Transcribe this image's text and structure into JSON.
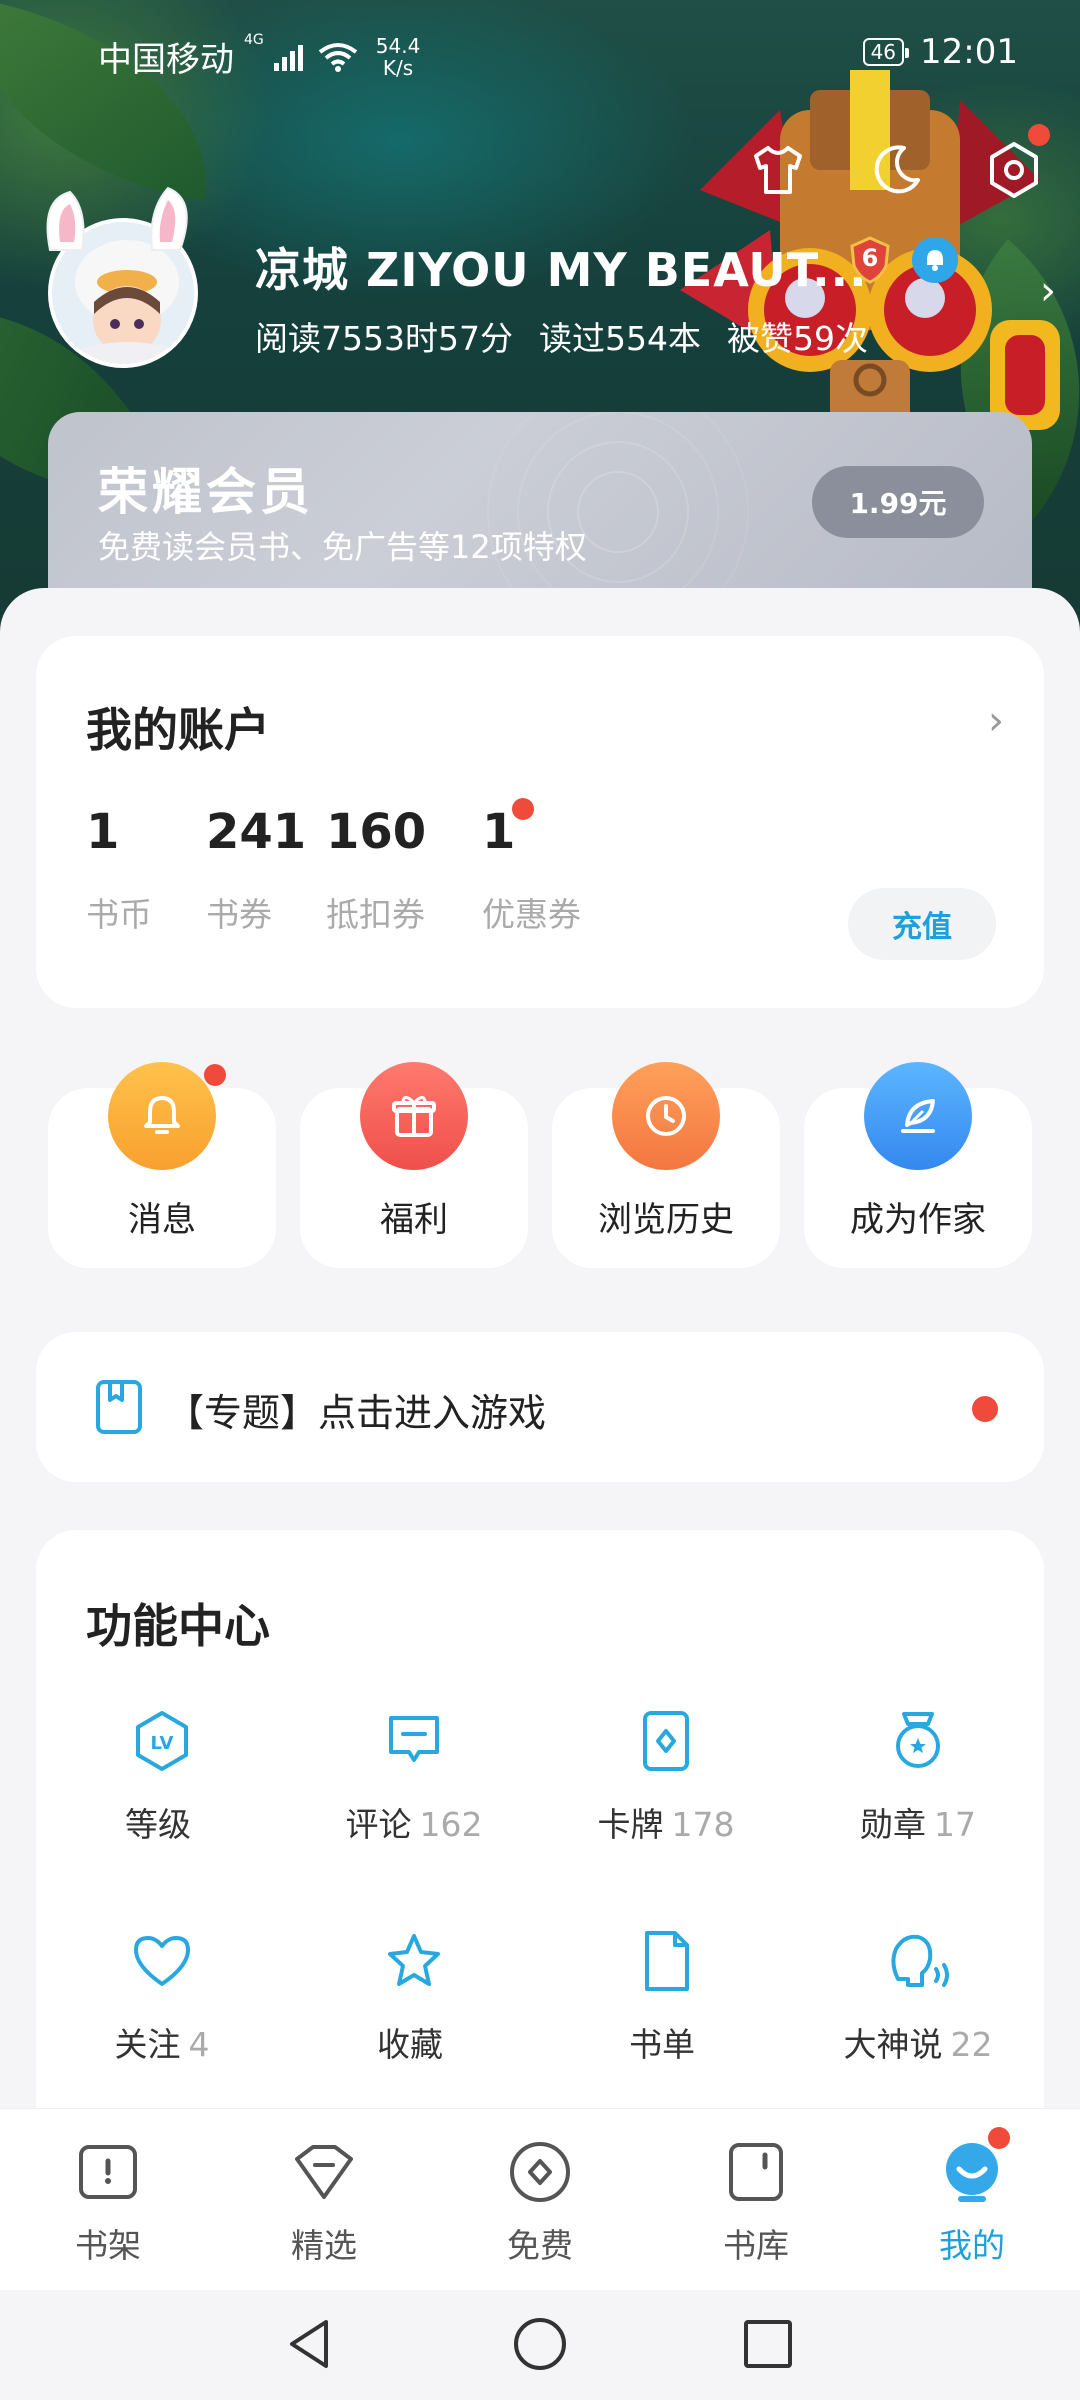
{
  "status_bar": {
    "carrier": "中国移动",
    "network": "4G",
    "speed_value": "54.4",
    "speed_unit": "K/s",
    "battery": "46",
    "time": "12:01"
  },
  "profile": {
    "name": "凉城 ZIYOU MY BEAUT...",
    "level_badge": "6",
    "stats": [
      "阅读7553时57分",
      "读过554本",
      "被赞59次"
    ]
  },
  "vip": {
    "title": "荣耀会员",
    "subtitle": "免费读会员书、免广告等12项特权",
    "price": "1.99元"
  },
  "account": {
    "title": "我的账户",
    "items": [
      {
        "value": "1",
        "label": "书币"
      },
      {
        "value": "241",
        "label": "书券"
      },
      {
        "value": "160",
        "label": "抵扣券"
      },
      {
        "value": "1",
        "label": "优惠券"
      }
    ],
    "recharge_label": "充值"
  },
  "quick_actions": [
    {
      "label": "消息",
      "icon": "bell-icon",
      "color": "#f9a93a"
    },
    {
      "label": "福利",
      "icon": "gift-icon",
      "color": "#f25f57"
    },
    {
      "label": "浏览历史",
      "icon": "clock-icon",
      "color": "#f7854a"
    },
    {
      "label": "成为作家",
      "icon": "feather-icon",
      "color": "#3f9df0"
    }
  ],
  "topic": {
    "text": "【专题】点击进入游戏"
  },
  "function_center": {
    "title": "功能中心",
    "items": [
      {
        "label": "等级",
        "count": "",
        "icon": "level-icon"
      },
      {
        "label": "评论",
        "count": "162",
        "icon": "comment-icon"
      },
      {
        "label": "卡牌",
        "count": "178",
        "icon": "card-icon"
      },
      {
        "label": "勋章",
        "count": "17",
        "icon": "medal-icon"
      },
      {
        "label": "关注",
        "count": "4",
        "icon": "heart-icon"
      },
      {
        "label": "收藏",
        "count": "",
        "icon": "star-icon"
      },
      {
        "label": "书单",
        "count": "",
        "icon": "booklist-icon"
      },
      {
        "label": "大神说",
        "count": "22",
        "icon": "speaker-icon"
      }
    ]
  },
  "bottom_nav": [
    {
      "label": "书架",
      "icon": "bookshelf-icon"
    },
    {
      "label": "精选",
      "icon": "featured-icon"
    },
    {
      "label": "免费",
      "icon": "free-icon"
    },
    {
      "label": "书库",
      "icon": "library-icon"
    },
    {
      "label": "我的",
      "icon": "profile-icon",
      "active": true
    }
  ],
  "colors": {
    "accent": "#1fa0dc",
    "notification": "#f04b3a",
    "icon_blue": "#29a8e0"
  }
}
